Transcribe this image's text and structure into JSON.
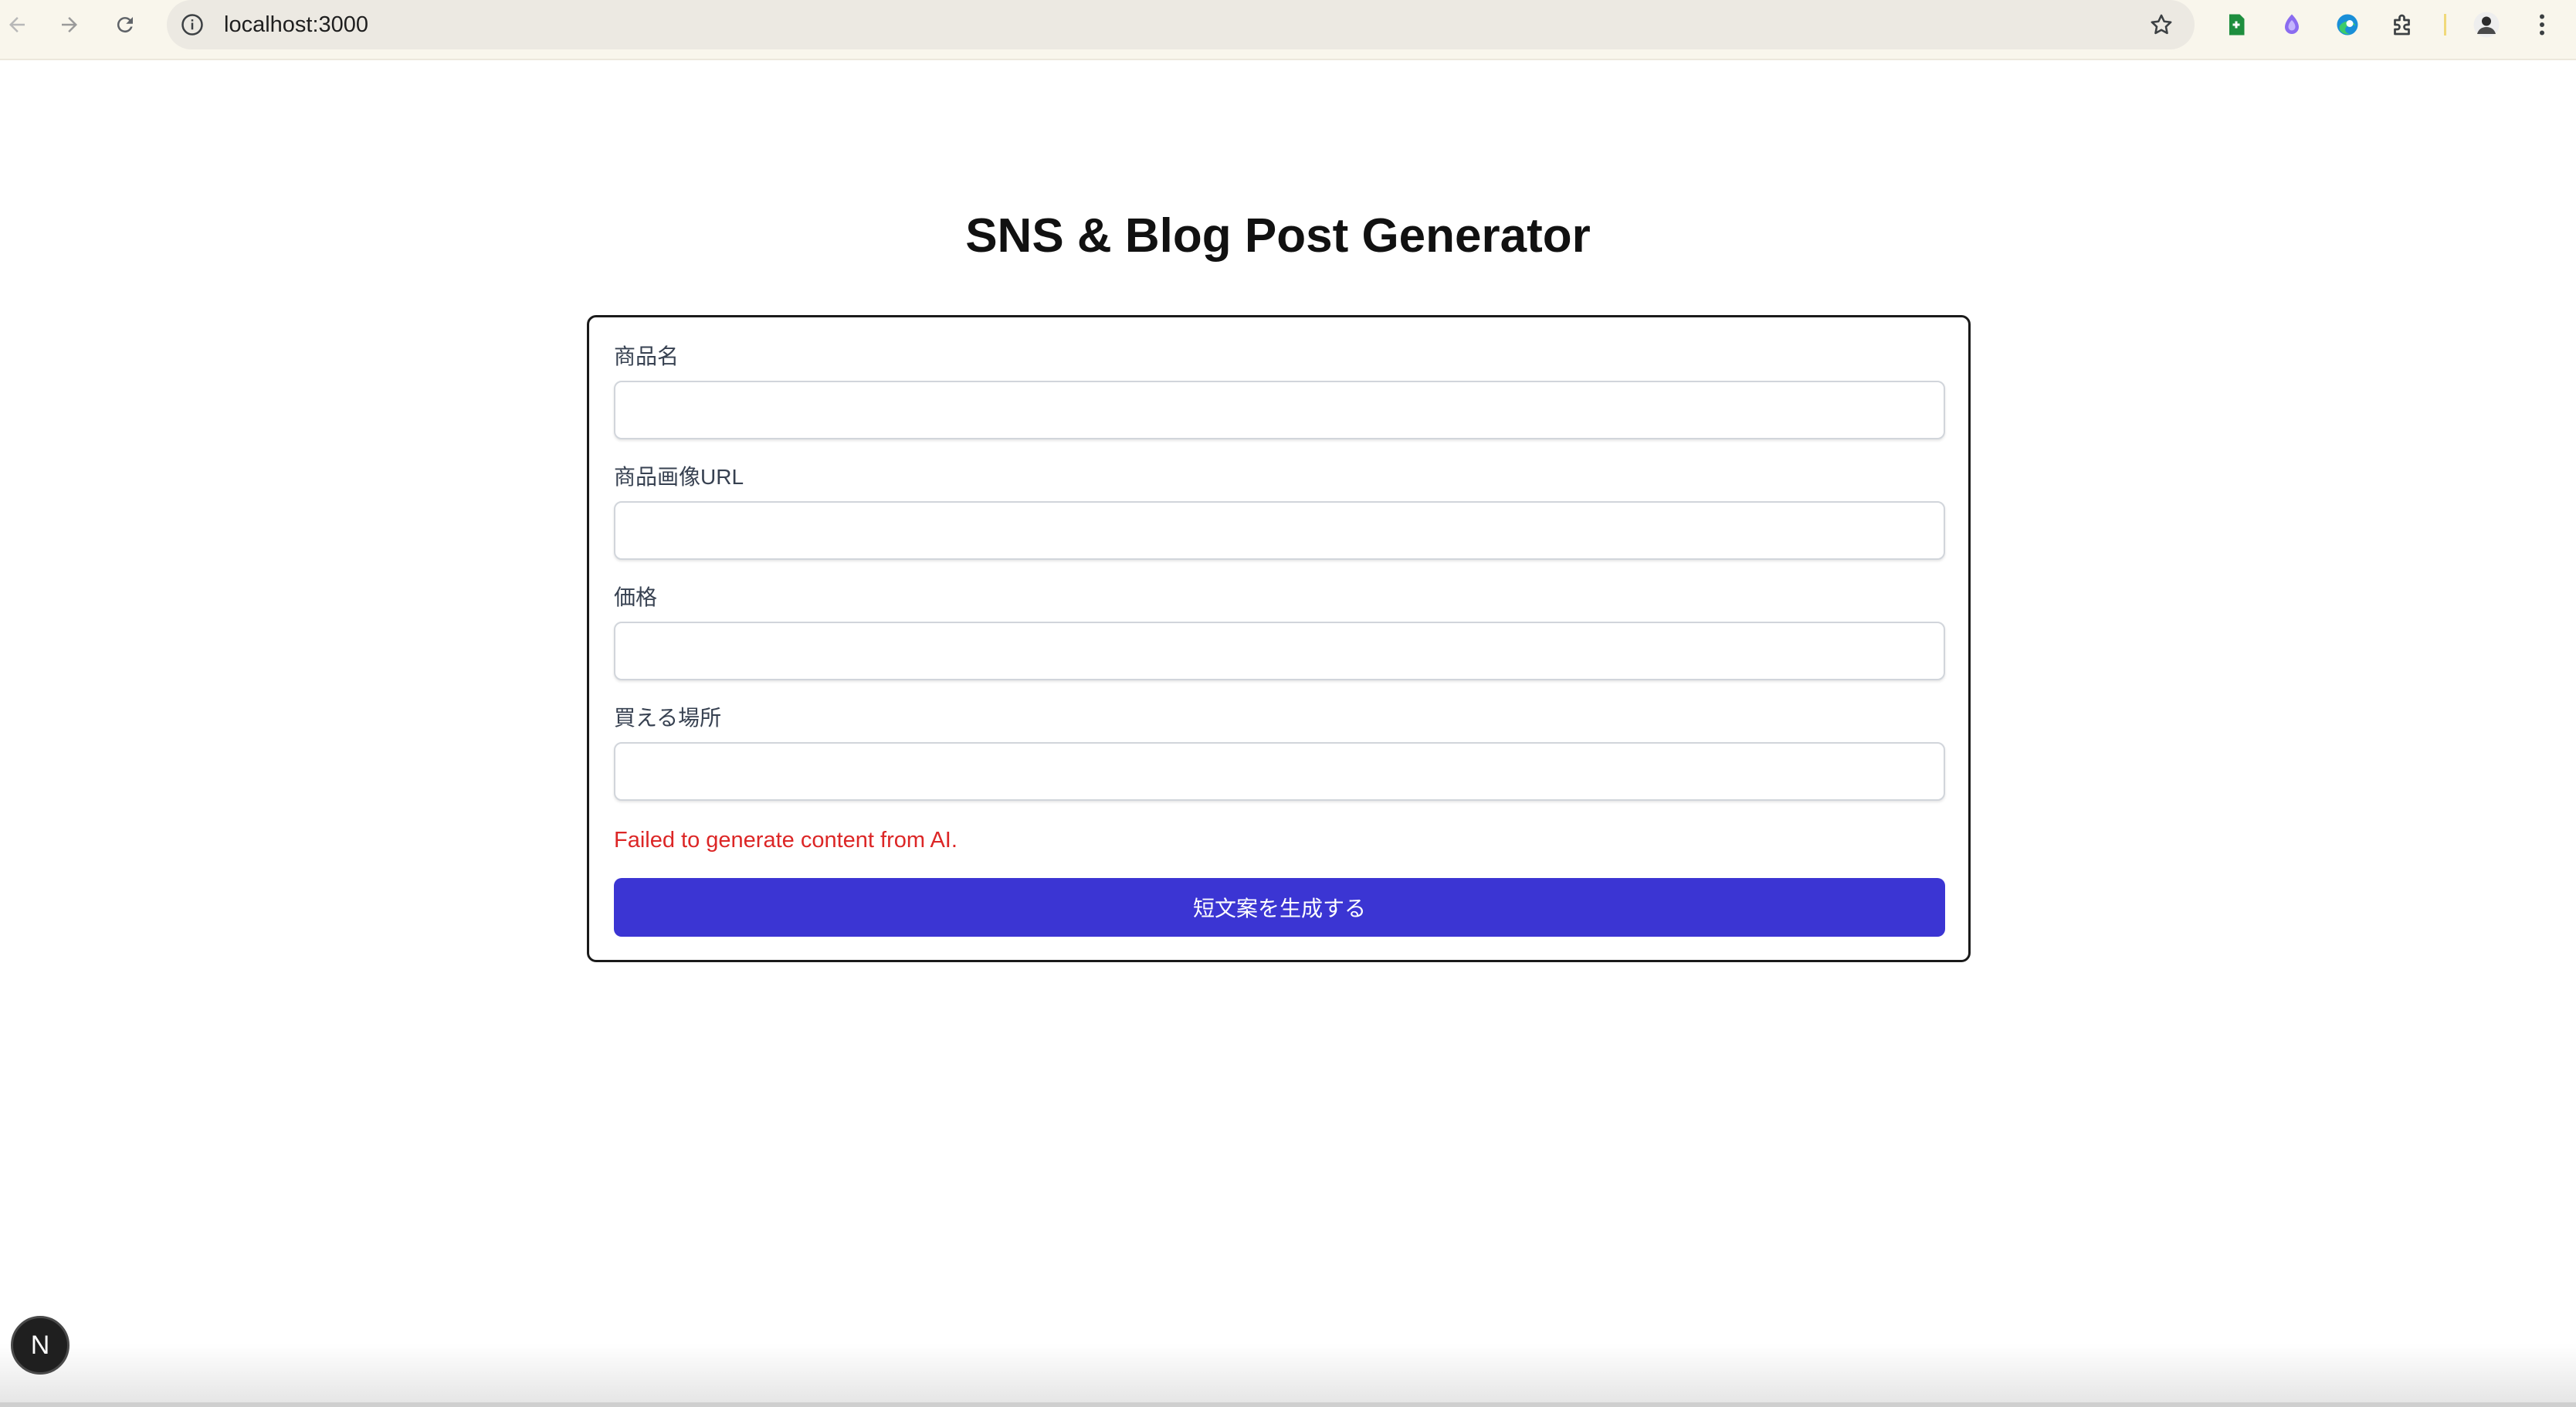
{
  "browser": {
    "url": "localhost:3000"
  },
  "page": {
    "title": "SNS & Blog Post Generator"
  },
  "form": {
    "fields": [
      {
        "label": "商品名",
        "value": "",
        "placeholder": ""
      },
      {
        "label": "商品画像URL",
        "value": "",
        "placeholder": ""
      },
      {
        "label": "価格",
        "value": "",
        "placeholder": ""
      },
      {
        "label": "買える場所",
        "value": "",
        "placeholder": ""
      }
    ],
    "error_message": "Failed to generate content from AI.",
    "submit_label": "短文案を生成する"
  },
  "badge": {
    "letter": "N"
  },
  "colors": {
    "accent": "#3b35d3",
    "error": "#dc2626",
    "chrome_bg": "#f9f6ec"
  },
  "icons": [
    "back-arrow-icon",
    "forward-arrow-icon",
    "reload-icon",
    "info-icon",
    "star-icon",
    "sheets-extension-icon",
    "purple-extension-icon",
    "edge-extension-icon",
    "puzzle-extensions-icon",
    "profile-avatar-icon",
    "kebab-menu-icon",
    "nextjs-logo-icon"
  ]
}
